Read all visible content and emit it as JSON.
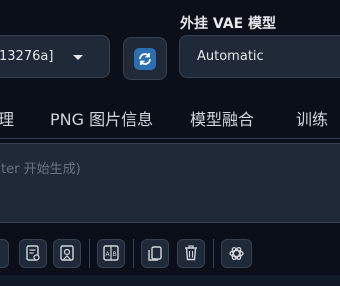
{
  "model": {
    "selected": "13276a]"
  },
  "vae": {
    "label": "外挂 VAE 模型",
    "selected": "Automatic"
  },
  "tabs": [
    {
      "label": "理"
    },
    {
      "label": "PNG 图片信息"
    },
    {
      "label": "模型融合"
    },
    {
      "label": "训练"
    }
  ],
  "prompt": {
    "placeholder": "ter 开始生成)"
  },
  "toolbar": {
    "icons": [
      "read-params-icon",
      "extra-networks-icon",
      "clear-prompt-icon",
      "apply-style-icon",
      "copy-style-icon",
      "delete-icon",
      "openai-icon"
    ]
  },
  "colors": {
    "background": "#0b0f19",
    "panel": "#1f2937",
    "accent": "#2b6fb0"
  }
}
